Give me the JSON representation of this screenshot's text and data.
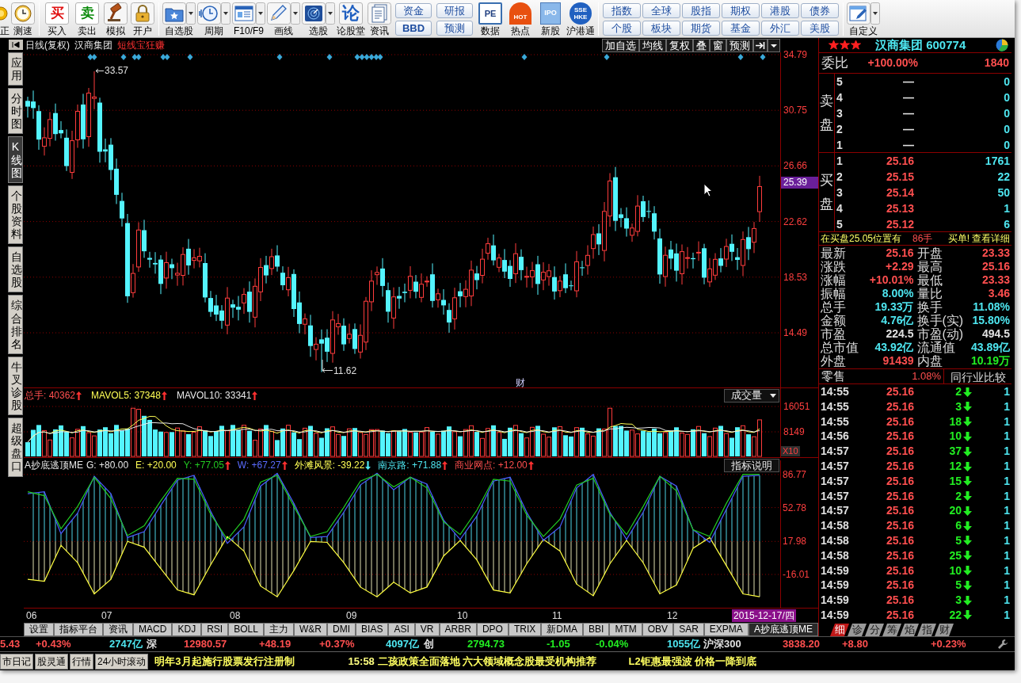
{
  "toolbar": {
    "groups": [
      [
        {
          "kind": "icon",
          "label": "正"
        },
        {
          "kind": "icon",
          "label": "测速"
        }
      ],
      [
        {
          "kind": "icon",
          "label": "买入",
          "glyph": "买"
        },
        {
          "kind": "icon",
          "label": "卖出",
          "glyph": "卖"
        },
        {
          "kind": "icon",
          "label": "模拟"
        },
        {
          "kind": "icon",
          "label": "开户"
        }
      ],
      [
        {
          "kind": "dropdown",
          "label": "自选股"
        },
        {
          "kind": "dropdown",
          "label": "周期"
        },
        {
          "kind": "dropdown",
          "label": "F10/F9"
        },
        {
          "kind": "dropdown",
          "label": "画线"
        },
        {
          "kind": "dropdown",
          "label": "选股"
        },
        {
          "kind": "icon",
          "label": "论股堂",
          "glyph": "论"
        },
        {
          "kind": "icon",
          "label": "资讯"
        },
        {
          "kind": "stacked",
          "labels": [
            "资金",
            "BBD"
          ]
        },
        {
          "kind": "stacked",
          "labels": [
            "研报",
            "预测"
          ]
        },
        {
          "kind": "icon",
          "label": "数据",
          "glyph": "PE"
        },
        {
          "kind": "icon",
          "label": "热点",
          "glyph": "HOT"
        },
        {
          "kind": "icon",
          "label": "新股",
          "glyph": "IPO"
        },
        {
          "kind": "icon",
          "label": "沪港通",
          "glyph": "SSE HKE"
        }
      ],
      [
        {
          "kind": "small",
          "label": "指数"
        },
        {
          "kind": "small",
          "label": "全球"
        },
        {
          "kind": "small",
          "label": "股指"
        },
        {
          "kind": "small",
          "label": "期权"
        },
        {
          "kind": "small",
          "label": "港股"
        },
        {
          "kind": "small",
          "label": "债券"
        },
        {
          "kind": "small",
          "label": "个股"
        },
        {
          "kind": "small",
          "label": "板块"
        },
        {
          "kind": "small",
          "label": "期货"
        },
        {
          "kind": "small",
          "label": "基金"
        },
        {
          "kind": "small",
          "label": "外汇"
        },
        {
          "kind": "small",
          "label": "美股"
        }
      ],
      [
        {
          "kind": "dropdown",
          "label": "自定义"
        }
      ]
    ]
  },
  "side_tabs": [
    {
      "label": "应用",
      "selected": false
    },
    {
      "label": "分时图",
      "selected": false
    },
    {
      "label": "K线图",
      "selected": true
    },
    {
      "label": "个股资料",
      "selected": false
    },
    {
      "label": "自选股",
      "selected": false
    },
    {
      "label": "综合排名",
      "selected": false
    },
    {
      "label": "牛叉诊股",
      "selected": false
    },
    {
      "label": "超级盘口",
      "selected": false
    }
  ],
  "chart": {
    "header": {
      "period": "日线(复权)",
      "stock": "汉商集团",
      "strategy": "短线宝狂赚",
      "buttons": [
        "加自选",
        "均线",
        "复权",
        "叠",
        "窗",
        "预测"
      ]
    },
    "price_axis": [
      "34.79",
      "30.75",
      "26.66",
      "22.62",
      "18.53",
      "14.49"
    ],
    "current_price": "25.39",
    "high_label": "33.57",
    "low_label": "11.62",
    "event_marker": "财",
    "volume_pane": {
      "series": [
        {
          "label": "总手: 40362",
          "color": "#ff4f4f",
          "up_arrow": true
        },
        {
          "label": "MAVOL5: 37348",
          "color": "#ffff55",
          "up_arrow": true
        },
        {
          "label": "MAVOL10: 33341",
          "color": "#e8e8e8",
          "up_arrow": true
        }
      ],
      "selector": "成交量",
      "axis": [
        "16051",
        "8149"
      ],
      "scale": "X10"
    },
    "indicator_pane": {
      "name": "A抄底逃顶ME",
      "series": [
        {
          "label": "G: +80.00",
          "color": "#e8e8e8"
        },
        {
          "label": "E: +20.00",
          "color": "#ffff55"
        },
        {
          "label": "Y: +77.05",
          "color": "#22cc22",
          "up_arrow": true
        },
        {
          "label": "W: +67.27",
          "color": "#5a6cff",
          "up_arrow": true
        },
        {
          "label": "外滩风景: -39.22",
          "color": "#ffff55",
          "down_arrow": true
        },
        {
          "label": "南京路: +71.88",
          "color": "#4ee6f0",
          "up_arrow": true
        },
        {
          "label": "商业网点: +12.00",
          "color": "#ff4f4f",
          "up_arrow": true
        }
      ],
      "help_button": "指标说明",
      "chart_data": {
        "type": "line",
        "ylim": [
          -51.1,
          101.4
        ],
        "yticks": [
          86.77,
          52.78,
          17.98,
          -16.01
        ],
        "grid": true,
        "series": [
          {
            "color": "#4a5cff",
            "values": [
              67,
              69,
              26,
              47,
              85,
              67,
              22,
              28,
              55,
              81,
              86,
              49,
              16,
              33,
              75,
              88,
              57,
              22,
              23,
              48,
              76,
              88,
              71,
              84,
              77,
              40,
              20,
              44,
              80,
              84,
              48,
              19,
              33,
              73,
              87,
              48,
              20,
              48,
              85,
              75,
              30,
              17,
              51,
              85,
              86
            ]
          },
          {
            "color": "#22cc22",
            "values": [
              69,
              65,
              31,
              54,
              84,
              62,
              24,
              34,
              60,
              83,
              82,
              46,
              20,
              41,
              79,
              86,
              54,
              23,
              28,
              53,
              80,
              87,
              74,
              84,
              73,
              38,
              25,
              50,
              82,
              80,
              45,
              23,
              41,
              76,
              83,
              46,
              25,
              54,
              85,
              70,
              30,
              23,
              57,
              87,
              87
            ]
          },
          {
            "color": "#ffff40",
            "values": [
              -21,
              -23,
              14,
              -4,
              -36,
              -21,
              18,
              12,
              -10,
              -32,
              -37,
              -6,
              23,
              8,
              -28,
              -39,
              -12,
              18,
              17,
              -4,
              -29,
              -39,
              -24,
              -35,
              -29,
              3,
              19,
              -1,
              -32,
              -35,
              -5,
              20,
              8,
              -26,
              -38,
              -5,
              19,
              -4,
              -36,
              -27,
              11,
              22,
              -7,
              -36,
              -39
            ]
          }
        ]
      }
    },
    "x_axis": {
      "months": [
        "06",
        "07",
        "08",
        "09",
        "10",
        "11",
        "12"
      ],
      "cursor_date": "2015-12-17/四"
    },
    "indicator_tabs": [
      {
        "label": "设置",
        "selected": false
      },
      {
        "label": "指标平台",
        "selected": false
      },
      {
        "label": "资讯",
        "selected": false
      },
      {
        "label": "MACD",
        "selected": false
      },
      {
        "label": "KDJ",
        "selected": false
      },
      {
        "label": "RSI",
        "selected": false
      },
      {
        "label": "BOLL",
        "selected": false
      },
      {
        "label": "主力",
        "selected": false
      },
      {
        "label": "W&R",
        "selected": false
      },
      {
        "label": "DMI",
        "selected": false
      },
      {
        "label": "BIAS",
        "selected": false
      },
      {
        "label": "ASI",
        "selected": false
      },
      {
        "label": "VR",
        "selected": false
      },
      {
        "label": "ARBR",
        "selected": false
      },
      {
        "label": "DPO",
        "selected": false
      },
      {
        "label": "TRIX",
        "selected": false
      },
      {
        "label": "新DMA",
        "selected": false
      },
      {
        "label": "BBI",
        "selected": false
      },
      {
        "label": "MTM",
        "selected": false
      },
      {
        "label": "OBV",
        "selected": false
      },
      {
        "label": "SAR",
        "selected": false
      },
      {
        "label": "EXPMA",
        "selected": false
      },
      {
        "label": "A抄底逃顶ME",
        "selected": true
      }
    ]
  },
  "quote": {
    "stars": 3,
    "title": "汉商集团 600774",
    "order_ratio": {
      "label": "委比",
      "percent": "+100.00%",
      "difference": "1840"
    },
    "ask": {
      "label": "卖盘",
      "levels": [
        {
          "level": "5",
          "price": "—",
          "volume": "0"
        },
        {
          "level": "4",
          "price": "—",
          "volume": "0"
        },
        {
          "level": "3",
          "price": "—",
          "volume": "0"
        },
        {
          "level": "2",
          "price": "—",
          "volume": "0"
        },
        {
          "level": "1",
          "price": "—",
          "volume": "0"
        }
      ]
    },
    "bid": {
      "label": "买盘",
      "levels": [
        {
          "level": "1",
          "price": "25.16",
          "volume": "1761"
        },
        {
          "level": "2",
          "price": "25.15",
          "volume": "22"
        },
        {
          "level": "3",
          "price": "25.14",
          "volume": "50"
        },
        {
          "level": "4",
          "price": "25.13",
          "volume": "1"
        },
        {
          "level": "5",
          "price": "25.12",
          "volume": "6"
        }
      ]
    },
    "notice": {
      "text": "在买盘25.05位置有",
      "volume": "86手",
      "suffix": "买单!",
      "link": "查看详细"
    },
    "stats": [
      {
        "label": "最新",
        "value": "25.16",
        "color": "#ff4f4f"
      },
      {
        "label": "开盘",
        "value": "23.33",
        "color": "#ff4f4f"
      },
      {
        "label": "涨跌",
        "value": "+2.29",
        "color": "#ff4f4f"
      },
      {
        "label": "最高",
        "value": "25.16",
        "color": "#ff4f4f"
      },
      {
        "label": "涨幅",
        "value": "+10.01%",
        "color": "#ff4f4f"
      },
      {
        "label": "最低",
        "value": "23.33",
        "color": "#ff4f4f"
      },
      {
        "label": "振幅",
        "value": "8.00%",
        "color": "#4ee6f0"
      },
      {
        "label": "量比",
        "value": "3.46",
        "color": "#ff4f4f"
      },
      {
        "label": "总手",
        "value": "19.33万",
        "color": "#4ee6f0"
      },
      {
        "label": "换手",
        "value": "11.08%",
        "color": "#4ee6f0"
      },
      {
        "label": "金额",
        "value": "4.76亿",
        "color": "#4ee6f0"
      },
      {
        "label": "换手(实)",
        "value": "15.80%",
        "color": "#4ee6f0"
      },
      {
        "label": "市盈",
        "value": "224.5",
        "color": "#e0e0e0"
      },
      {
        "label": "市盈(动)",
        "value": "494.5",
        "color": "#e0e0e0"
      },
      {
        "label": "总市值",
        "value": "43.92亿",
        "color": "#4ee6f0"
      },
      {
        "label": "流通值",
        "value": "43.89亿",
        "color": "#4ee6f0"
      },
      {
        "label": "外盘",
        "value": "91439",
        "color": "#ff4f4f"
      },
      {
        "label": "内盘",
        "value": "10.19万",
        "color": "#22ee22"
      }
    ],
    "retail": {
      "label": "零售",
      "value": "1.08%",
      "compare_button": "同行业比较"
    },
    "ticks": [
      {
        "time": "14:55",
        "price": "25.16",
        "volume": "2",
        "down_arrow": true,
        "column_4": "1"
      },
      {
        "time": "14:55",
        "price": "25.16",
        "volume": "3",
        "down_arrow": true,
        "column_4": "1"
      },
      {
        "time": "14:55",
        "price": "25.16",
        "volume": "18",
        "down_arrow": true,
        "column_4": "1"
      },
      {
        "time": "14:56",
        "price": "25.16",
        "volume": "10",
        "down_arrow": true,
        "column_4": "1"
      },
      {
        "time": "14:57",
        "price": "25.16",
        "volume": "37",
        "down_arrow": true,
        "column_4": "1"
      },
      {
        "time": "14:57",
        "price": "25.16",
        "volume": "12",
        "down_arrow": true,
        "column_4": "1"
      },
      {
        "time": "14:57",
        "price": "25.16",
        "volume": "15",
        "down_arrow": true,
        "column_4": "1"
      },
      {
        "time": "14:57",
        "price": "25.16",
        "volume": "2",
        "down_arrow": true,
        "column_4": "1"
      },
      {
        "time": "14:57",
        "price": "25.16",
        "volume": "20",
        "down_arrow": true,
        "column_4": "1"
      },
      {
        "time": "14:58",
        "price": "25.16",
        "volume": "6",
        "down_arrow": true,
        "column_4": "1"
      },
      {
        "time": "14:58",
        "price": "25.16",
        "volume": "5",
        "down_arrow": true,
        "column_4": "1"
      },
      {
        "time": "14:58",
        "price": "25.16",
        "volume": "25",
        "down_arrow": true,
        "column_4": "1"
      },
      {
        "time": "14:59",
        "price": "25.16",
        "volume": "10",
        "down_arrow": true,
        "column_4": "1"
      },
      {
        "time": "14:59",
        "price": "25.16",
        "volume": "5",
        "down_arrow": true,
        "column_4": "1"
      },
      {
        "time": "14:59",
        "price": "25.16",
        "volume": "3",
        "down_arrow": true,
        "column_4": "1"
      },
      {
        "time": "14:59",
        "price": "25.16",
        "volume": "22",
        "down_arrow": true,
        "column_4": "1"
      }
    ],
    "tabs": [
      {
        "label": "细",
        "selected": true
      },
      {
        "label": "诊",
        "selected": false
      },
      {
        "label": "分",
        "selected": false
      },
      {
        "label": "筹",
        "selected": false
      },
      {
        "label": "焰",
        "selected": false
      },
      {
        "label": "指",
        "selected": false
      },
      {
        "label": "财",
        "selected": false
      }
    ]
  },
  "index_ticker": [
    {
      "change": "5.43",
      "percent": "+0.43%",
      "amount": "2747亿",
      "rising": true
    },
    {
      "name": "深",
      "close": "12980.57",
      "change": "+48.19",
      "percent": "+0.37%",
      "amount": "4097亿",
      "rising": true
    },
    {
      "name": "创",
      "close": "2794.73",
      "change": "-1.05",
      "percent": "-0.04%",
      "amount": "1055亿",
      "rising": false
    },
    {
      "name": "沪深300",
      "close": "3838.20",
      "change": "+8.80",
      "percent": "+0.23%",
      "rising": true
    }
  ],
  "news": {
    "tabs": [
      "市日记",
      "股灵通",
      "行情",
      "24小时滚动"
    ],
    "headlines": [
      {
        "text": "明年3月起施行股票发行注册制"
      },
      {
        "time": "15:58",
        "text": "二孩政策全面落地 六大领域概念股最受机构推荐"
      },
      {
        "text": "L2钜惠最强波 价格一降到底"
      }
    ]
  }
}
